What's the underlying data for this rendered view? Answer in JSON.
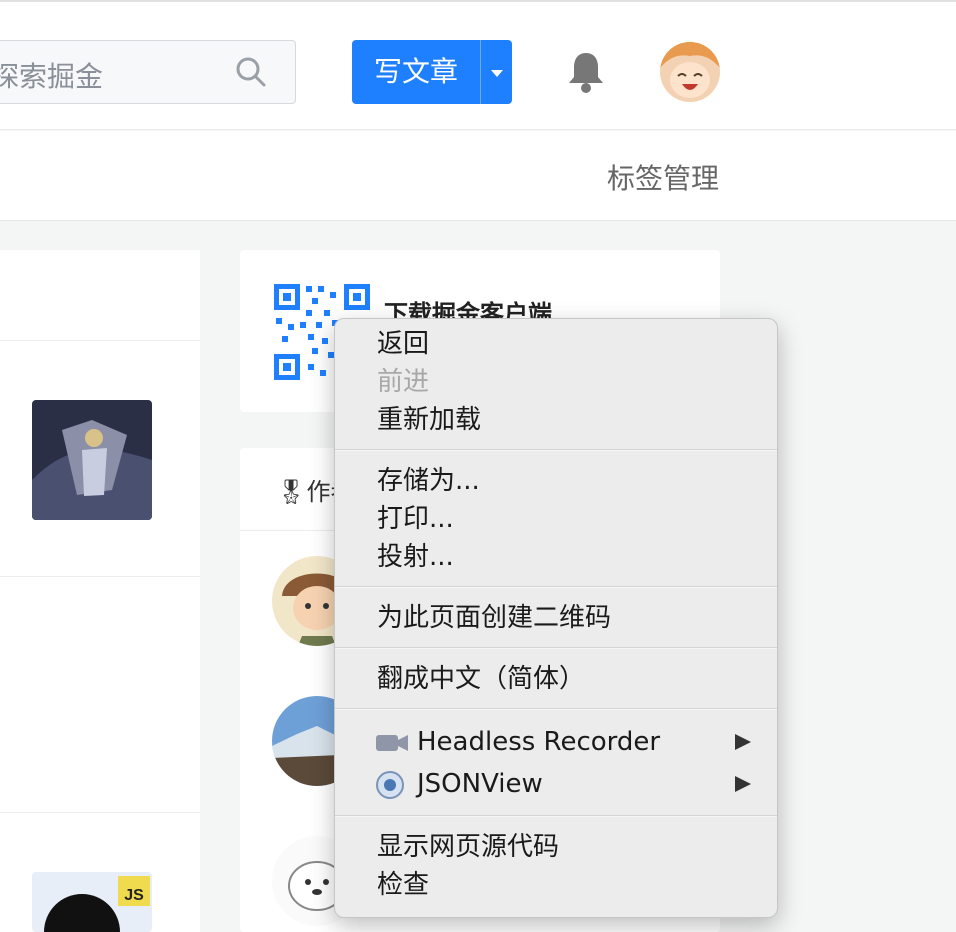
{
  "header": {
    "search_placeholder": "探索掘金",
    "write_button_label": "写文章",
    "icons": [
      "search-icon",
      "chevron-down-icon",
      "bell-icon",
      "avatar"
    ]
  },
  "subnav": {
    "tag_manage_label": "标签管理"
  },
  "sidebar": {
    "download_title": "下载掘金客户端",
    "authors_heading": "作者榜",
    "authors_heading_visible": "🎖作者"
  },
  "thumbnail_badge": "JS",
  "context_menu": {
    "groups": [
      [
        {
          "label": "返回",
          "enabled": true
        },
        {
          "label": "前进",
          "enabled": false
        },
        {
          "label": "重新加载",
          "enabled": true
        }
      ],
      [
        {
          "label": "存储为...",
          "enabled": true
        },
        {
          "label": "打印...",
          "enabled": true
        },
        {
          "label": "投射...",
          "enabled": true
        }
      ],
      [
        {
          "label": "为此页面创建二维码",
          "enabled": true
        }
      ],
      [
        {
          "label": "翻成中文（简体）",
          "enabled": true
        }
      ],
      [
        {
          "label": "Headless Recorder",
          "icon": "camera-icon",
          "submenu": true
        },
        {
          "label": "JSONView",
          "icon": "jsonview-icon",
          "submenu": true
        }
      ],
      [
        {
          "label": "显示网页源代码",
          "enabled": true
        },
        {
          "label": "检查",
          "enabled": true
        }
      ]
    ]
  },
  "colors": {
    "brand_blue": "#1e80ff",
    "menu_bg": "#ececec",
    "page_bg": "#f4f5f5"
  }
}
